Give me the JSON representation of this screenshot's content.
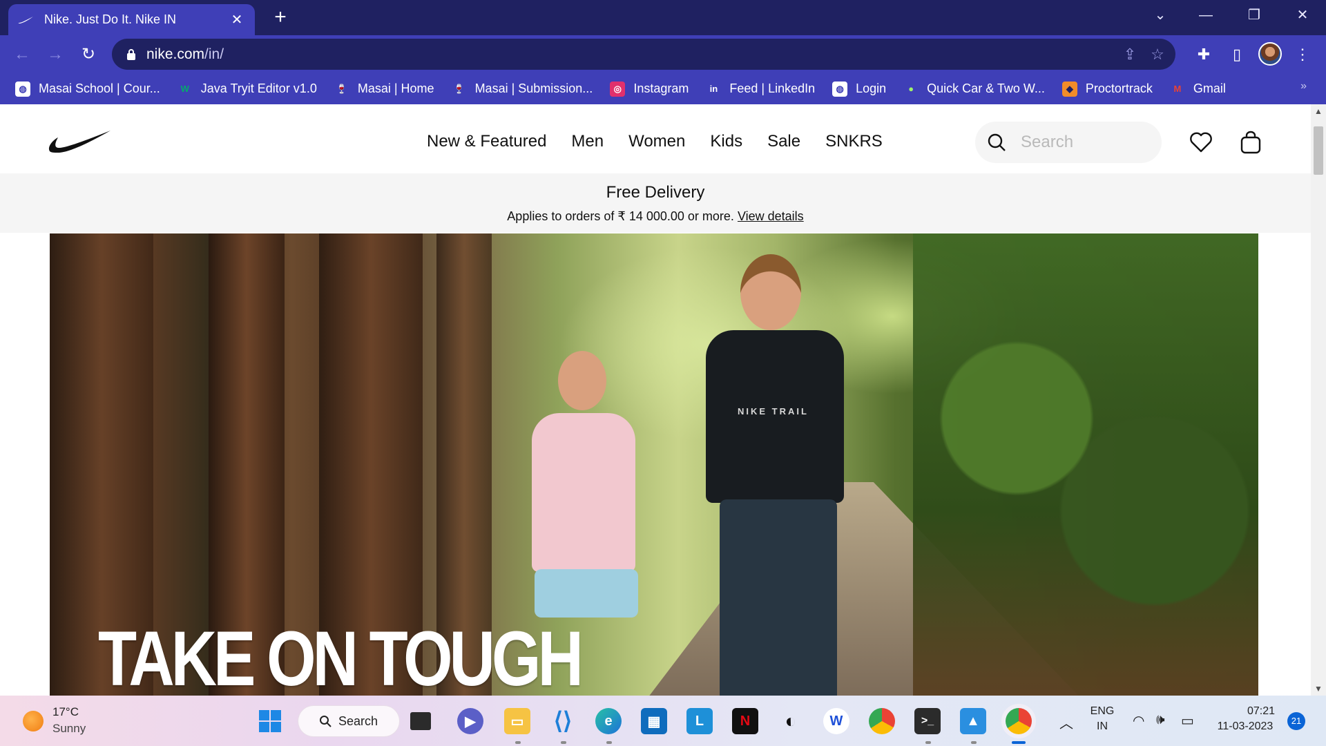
{
  "browser": {
    "tab_title": "Nike. Just Do It. Nike IN",
    "tab_close": "✕",
    "new_tab": "+",
    "url_host": "nike.com",
    "url_path": "/in/",
    "bookmarks": [
      {
        "label": "Masai School | Cour...",
        "icon_bg": "#ffffff",
        "icon_fg": "#3f3fb7",
        "glyph": "◍"
      },
      {
        "label": "Java Tryit Editor v1.0",
        "icon_bg": "transparent",
        "icon_fg": "#04aa6d",
        "glyph": "W"
      },
      {
        "label": "Masai | Home",
        "icon_bg": "transparent",
        "icon_fg": "#e74c3c",
        "glyph": "🍷"
      },
      {
        "label": "Masai | Submission...",
        "icon_bg": "transparent",
        "icon_fg": "#e74c3c",
        "glyph": "🍷"
      },
      {
        "label": "Instagram",
        "icon_bg": "#e1306c",
        "icon_fg": "#ffffff",
        "glyph": "◎"
      },
      {
        "label": "Feed | LinkedIn",
        "icon_bg": "transparent",
        "icon_fg": "#ffffff",
        "glyph": "in"
      },
      {
        "label": "Login",
        "icon_bg": "#ffffff",
        "icon_fg": "#3f3fb7",
        "glyph": "◍"
      },
      {
        "label": "Quick Car & Two W...",
        "icon_bg": "transparent",
        "icon_fg": "#9ef26a",
        "glyph": "●"
      },
      {
        "label": "Proctortrack",
        "icon_bg": "#f28c28",
        "icon_fg": "#1f2161",
        "glyph": "◆"
      },
      {
        "label": "Gmail",
        "icon_bg": "transparent",
        "icon_fg": "#ea4335",
        "glyph": "M"
      }
    ],
    "bookmarks_more": "»"
  },
  "nike": {
    "nav": [
      "New & Featured",
      "Men",
      "Women",
      "Kids",
      "Sale",
      "SNKRS"
    ],
    "search_placeholder": "Search",
    "promo_title": "Free Delivery",
    "promo_text": "Applies to orders of ₹ 14 000.00 or more.",
    "promo_link": "View details",
    "hero_heading": "TAKE ON TOUGH",
    "shirt_logo_text": "NIKE TRAIL"
  },
  "taskbar": {
    "weather_temp": "17°C",
    "weather_condition": "Sunny",
    "search_label": "Search",
    "language_line1": "ENG",
    "language_line2": "IN",
    "time": "07:21",
    "date": "11-03-2023",
    "notification_count": "21"
  },
  "colors": {
    "chrome_dark": "#1f2161",
    "chrome_accent": "#3f3fb7",
    "nike_text": "#111111",
    "promo_bg": "#f5f5f5"
  }
}
